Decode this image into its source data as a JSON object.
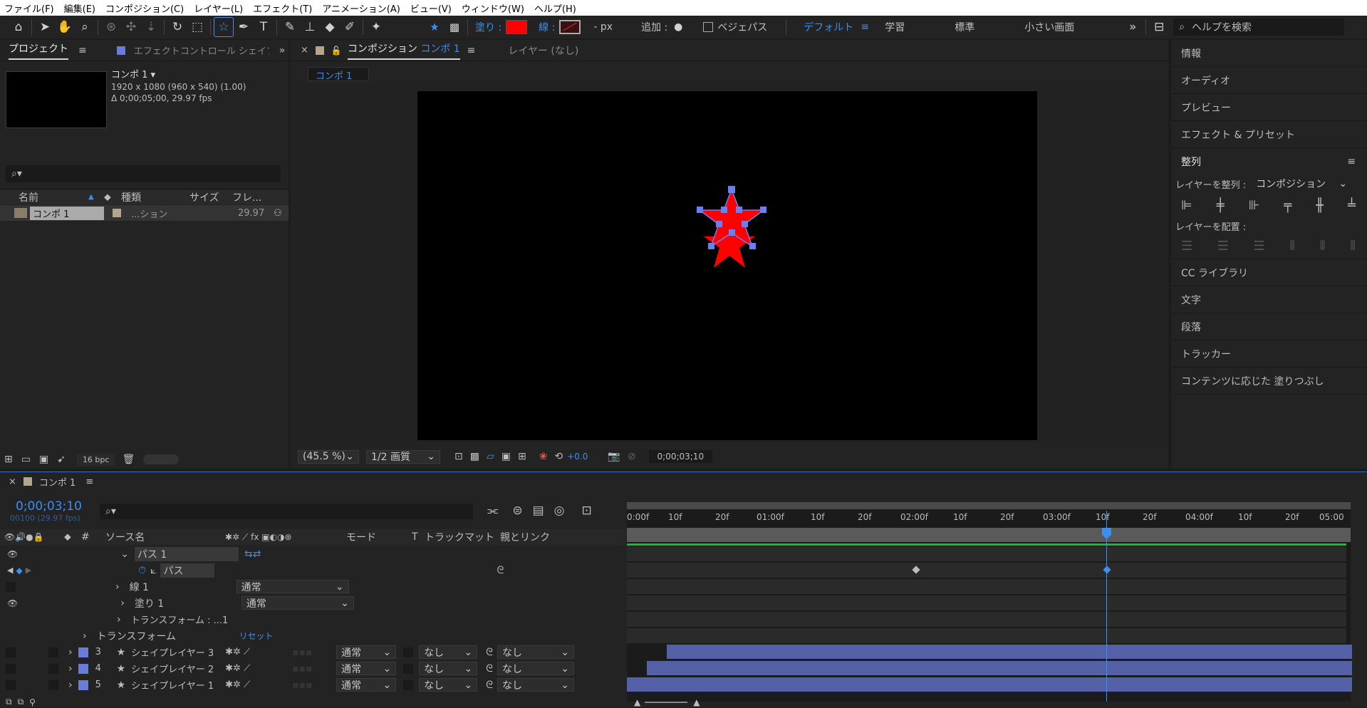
{
  "menu": [
    "ファイル(F)",
    "編集(E)",
    "コンポジション(C)",
    "レイヤー(L)",
    "エフェクト(T)",
    "アニメーション(A)",
    "ビュー(V)",
    "ウィンドウ(W)",
    "ヘルプ(H)"
  ],
  "toolbar": {
    "fill_label": "塗り :",
    "stroke_label": "線 :",
    "px_label": "- px",
    "add_label": "追加 :",
    "bezier_label": "ベジェパス",
    "workspaces": [
      "デフォルト",
      "学習",
      "標準",
      "小さい画面"
    ],
    "search_placeholder": "ヘルプを検索",
    "fill_color": "#ff0000"
  },
  "project": {
    "tab_project": "プロジェクト",
    "tab_effect": "エフェクトコントロール シェイプ",
    "comp_name": "コンポ 1",
    "comp_info1": "1920 x 1080  (960 x 540) (1.00)",
    "comp_info2": "Δ 0;00;05;00, 29.97 fps",
    "col_name": "名前",
    "col_type": "種類",
    "col_size": "サイズ",
    "col_frame": "フレ...",
    "item_name": "コンポ 1",
    "item_type": "...ション",
    "item_fps": "29.97",
    "bpc": "16 bpc"
  },
  "composition": {
    "tab_comp_prefix": "コンポジション",
    "tab_comp_name": "コンポ 1",
    "tab_layer": "レイヤー (なし)",
    "sub_tab": "コンポ 1",
    "zoom": "(45.5 %)",
    "quality": "1/2 画質",
    "exposure": "+0.0",
    "timecode": "0;00;03;10"
  },
  "right_panel": {
    "items_top": [
      "情報",
      "オーディオ",
      "プレビュー",
      "エフェクト & プリセット"
    ],
    "align_title": "整列",
    "align_to_label": "レイヤーを整列 :",
    "align_to_value": "コンポジション",
    "distribute_label": "レイヤーを配置 :",
    "items_bottom": [
      "CC ライブラリ",
      "文字",
      "段落",
      "トラッカー",
      "コンテンツに応じた 塗りつぶし"
    ]
  },
  "timeline": {
    "tab": "コンポ 1",
    "timecode": "0;00;03;10",
    "frame_info": "00100 (29.97 fps)",
    "col_source": "ソース名",
    "col_mode": "モード",
    "col_t": "T",
    "col_track": "トラックマット",
    "col_parent": "親とリンク",
    "path_group": "パス 1",
    "path_prop": "パス",
    "stroke": "線 1",
    "fill": "塗り 1",
    "transform_sub": "トランスフォーム : ...1",
    "transform": "トランスフォーム",
    "reset": "リセット",
    "mode_normal": "通常",
    "none": "なし",
    "layers": [
      {
        "num": "3",
        "name": "シェイプレイヤー 3"
      },
      {
        "num": "4",
        "name": "シェイプレイヤー 2"
      },
      {
        "num": "5",
        "name": "シェイプレイヤー 1"
      }
    ],
    "ruler": [
      "0:00f",
      "10f",
      "20f",
      "01:00f",
      "10f",
      "20f",
      "02:00f",
      "10f",
      "20f",
      "03:00f",
      "10f",
      "20f",
      "04:00f",
      "10f",
      "20f",
      "05:00"
    ]
  }
}
